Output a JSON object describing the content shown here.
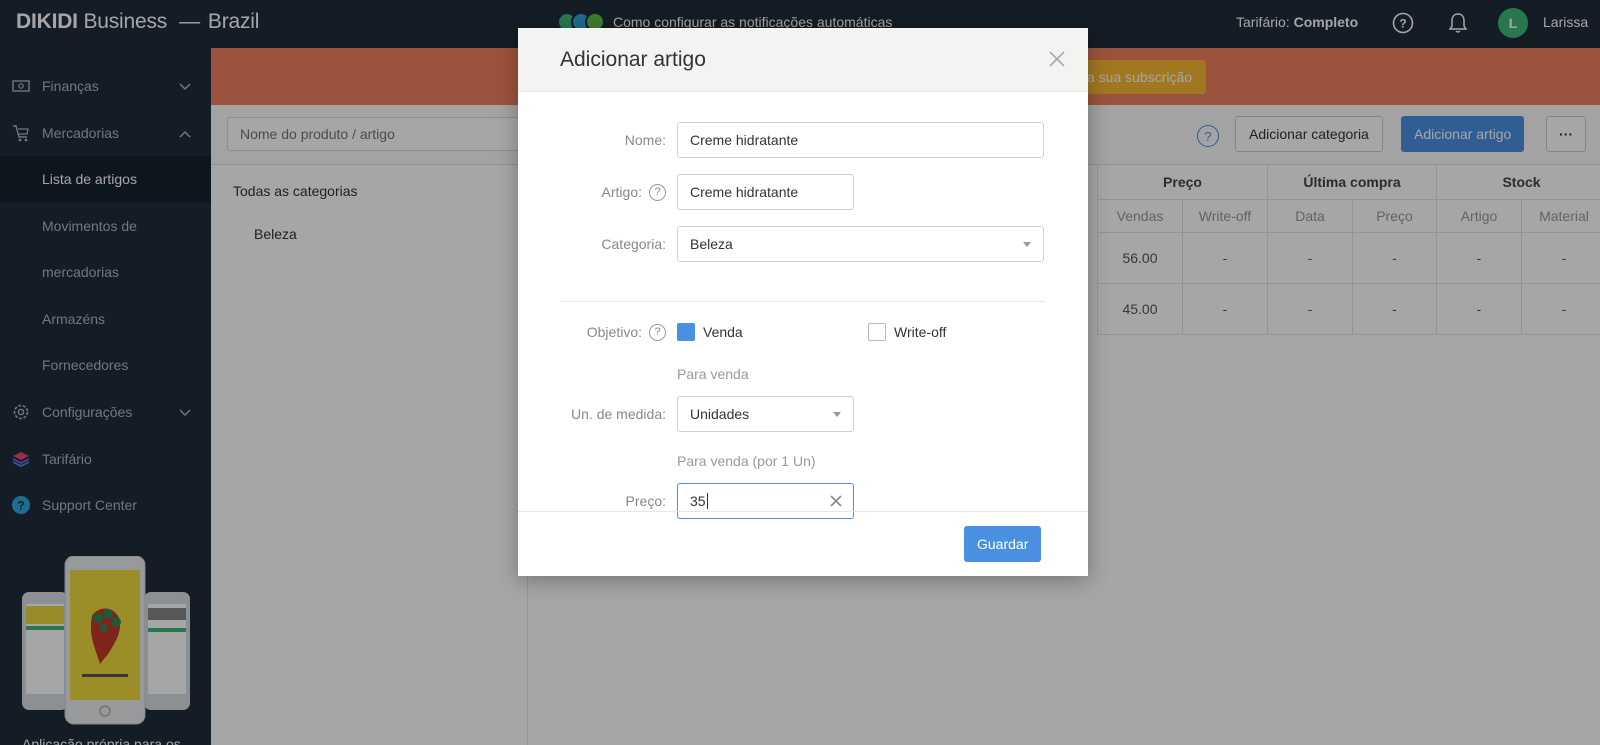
{
  "header": {
    "brand_name": "DIKIDI",
    "brand_suffix": "Business",
    "dash": "—",
    "region": "Brazil",
    "notification_text": "Como configurar as notificações automáticas",
    "tariff_label": "Tarifário:",
    "tariff_value": "Completo",
    "avatar_letter": "L",
    "username": "Larissa"
  },
  "sidebar": {
    "items": [
      {
        "label": "Finanças",
        "icon": "cash-icon"
      },
      {
        "label": "Mercadorias",
        "icon": "cart-icon"
      },
      {
        "label": "Lista de artigos"
      },
      {
        "label": "Movimentos de"
      },
      {
        "label": "mercadorias"
      },
      {
        "label": "Armazéns"
      },
      {
        "label": "Fornecedores"
      },
      {
        "label": "Configurações",
        "icon": "gear-icon"
      },
      {
        "label": "Tarifário",
        "icon": "layers-icon"
      },
      {
        "label": "Support Center",
        "icon": "question-circle-icon"
      }
    ],
    "footer_text": "Aplicação própria para os"
  },
  "main": {
    "banner_button": "a sua subscrição",
    "search_placeholder": "Nome do produto / artigo",
    "help": "?",
    "add_category": "Adicionar categoria",
    "add_article": "Adicionar artigo",
    "more": "···",
    "categories": {
      "all": "Todas as categorias",
      "sub": "Beleza"
    },
    "table": {
      "groups": [
        "Preço",
        "Última compra",
        "Stock"
      ],
      "subheaders": [
        "Vendas",
        "Write-off",
        "Data",
        "Preço",
        "Artigo",
        "Material"
      ],
      "rows": [
        [
          "56.00",
          "-",
          "-",
          "-",
          "-",
          "-"
        ],
        [
          "45.00",
          "-",
          "-",
          "-",
          "-",
          "-"
        ]
      ]
    }
  },
  "modal": {
    "title": "Adicionar artigo",
    "close": "×",
    "name_label": "Nome:",
    "name_value": "Creme hidratante",
    "article_label": "Artigo:",
    "article_value": "Creme hidratante",
    "category_label": "Categoria:",
    "category_value": "Beleza",
    "objective_label": "Objetivo:",
    "venda_label": "Venda",
    "venda_checked": true,
    "writeoff_label": "Write-off",
    "writeoff_checked": false,
    "para_venda": "Para venda",
    "unit_label": "Un. de medida:",
    "unit_value": "Unidades",
    "para_venda_per_unit": "Para venda (por 1 Un)",
    "price_label": "Preço:",
    "price_value": "35",
    "save_button": "Guardar"
  },
  "colors": {
    "topbar": "#1f2d3a",
    "accent": "#4a90e2",
    "banner": "#f0805e",
    "avatar": "#3cb878"
  }
}
